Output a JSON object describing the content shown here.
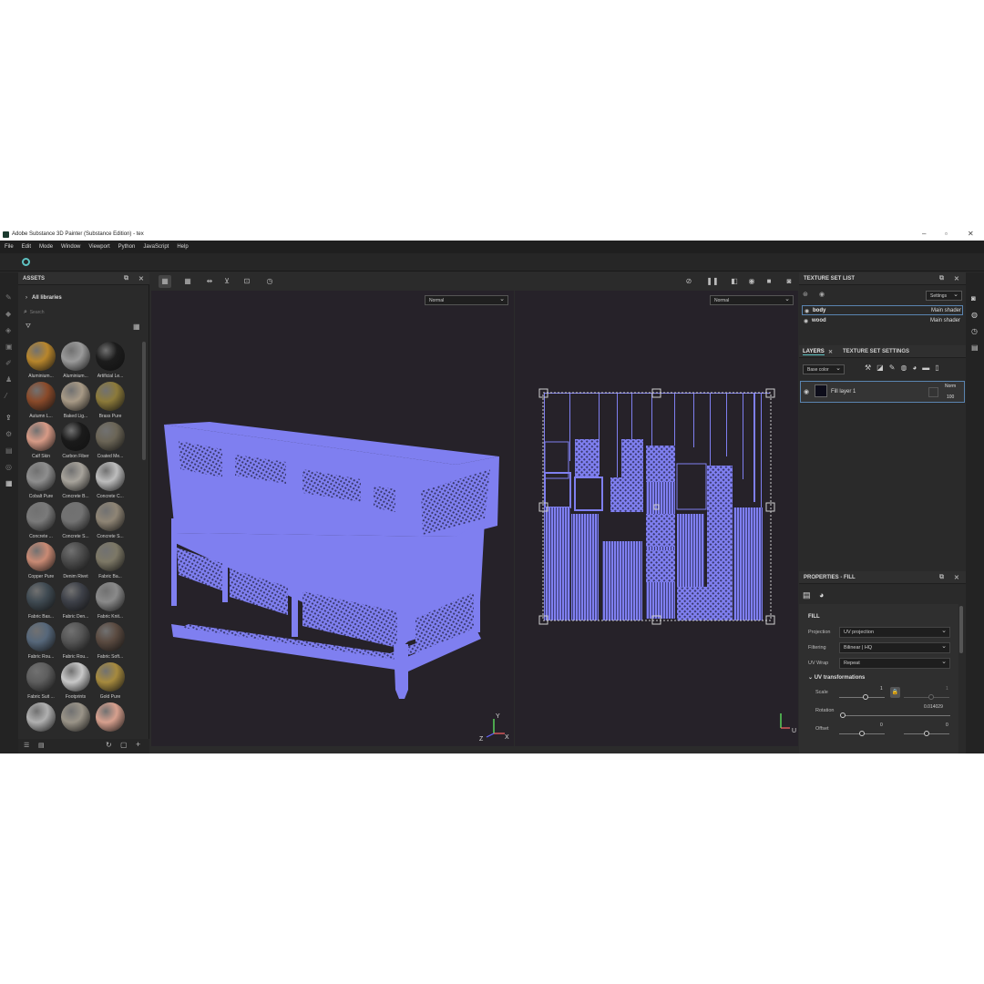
{
  "window": {
    "title": "Adobe Substance 3D Painter (Substance Edition) - tex"
  },
  "menu": [
    "File",
    "Edit",
    "Mode",
    "Window",
    "Viewport",
    "Python",
    "JavaScript",
    "Help"
  ],
  "assets": {
    "title": "ASSETS",
    "library": "All libraries",
    "search_placeholder": "Search",
    "materials": [
      {
        "label": "Aluminium...",
        "color": "#b8862c"
      },
      {
        "label": "Aluminium...",
        "color": "#9a9a9a"
      },
      {
        "label": "Artificial Le...",
        "color": "#1c1c1c"
      },
      {
        "label": "Autumn L...",
        "color": "#8a4a2a"
      },
      {
        "label": "Baked Lig...",
        "color": "#a89a86"
      },
      {
        "label": "Brass Pure",
        "color": "#8c7a3a"
      },
      {
        "label": "Calf Skin",
        "color": "#d79a86"
      },
      {
        "label": "Carbon Fiber",
        "color": "#1a1a1a"
      },
      {
        "label": "Coated Me...",
        "color": "#6b6556"
      },
      {
        "label": "Cobalt Pure",
        "color": "#8e8e8e"
      },
      {
        "label": "Concrete B...",
        "color": "#a7a39b"
      },
      {
        "label": "Concrete C...",
        "color": "#bdbdbd"
      },
      {
        "label": "Concrete ...",
        "color": "#7a7a7a"
      },
      {
        "label": "Concrete S...",
        "color": "#727272"
      },
      {
        "label": "Concrete S...",
        "color": "#8f8575"
      },
      {
        "label": "Copper Pure",
        "color": "#c98a74"
      },
      {
        "label": "Denim Rivet",
        "color": "#4b4b4b"
      },
      {
        "label": "Fabric Ba...",
        "color": "#7d7866"
      },
      {
        "label": "Fabric Bas...",
        "color": "#3f4a52"
      },
      {
        "label": "Fabric Den...",
        "color": "#3d4048"
      },
      {
        "label": "Fabric Knit...",
        "color": "#8a8a8a"
      },
      {
        "label": "Fabric Rou...",
        "color": "#56677a"
      },
      {
        "label": "Fabric Rou...",
        "color": "#555555"
      },
      {
        "label": "Fabric Soft...",
        "color": "#5a4a40"
      },
      {
        "label": "Fabric Suit ...",
        "color": "#5e5e5e"
      },
      {
        "label": "Footprints",
        "color": "#c8c8c8"
      },
      {
        "label": "Gold Pure",
        "color": "#a68a3e"
      },
      {
        "label": "",
        "color": "#b0b0b0"
      },
      {
        "label": "",
        "color": "#9a9488"
      },
      {
        "label": "",
        "color": "#d7a08e"
      }
    ]
  },
  "viewport": {
    "mode3d": "Normal",
    "mode2d": "Normal",
    "mesh_color": "#7f7ff0",
    "axis_z": "Z",
    "axis_y": "Y",
    "axis_x": "X",
    "axis_u": "U"
  },
  "texture_set_list": {
    "title": "TEXTURE SET LIST",
    "settings": "Settings",
    "items": [
      {
        "name": "body",
        "shader": "Main shader"
      },
      {
        "name": "wood",
        "shader": "Main shader"
      }
    ]
  },
  "layers": {
    "tab1": "LAYERS",
    "tab2": "TEXTURE SET SETTINGS",
    "channel": "Base color",
    "layer_name": "Fill layer 1",
    "blend": "Norm",
    "opacity": "100"
  },
  "properties": {
    "title": "PROPERTIES - FILL",
    "section": "FILL",
    "projection_label": "Projection",
    "projection_value": "UV projection",
    "filtering_label": "Filtering",
    "filtering_value": "Bilinear | HQ",
    "uvwrap_label": "UV Wrap",
    "uvwrap_value": "Repeat",
    "uvt_label": "UV transformations",
    "scale_label": "Scale",
    "scale_value": "1",
    "scale_value2": "1",
    "rotation_label": "Rotation",
    "rotation_value": "0.014029",
    "offset_label": "Offset",
    "offset_value1": "0",
    "offset_value2": "0"
  }
}
